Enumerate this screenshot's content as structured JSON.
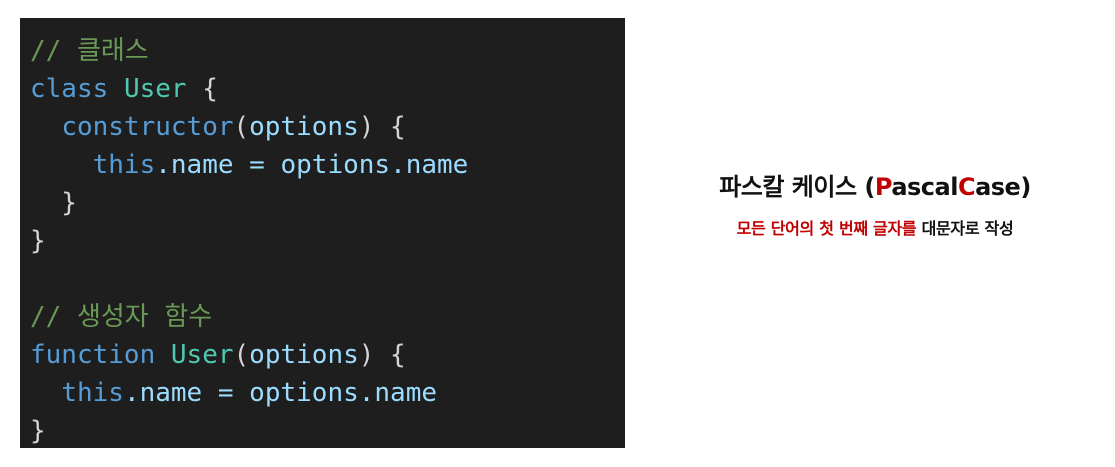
{
  "code": {
    "comment_class": "// 클래스",
    "kw_class": "class",
    "class_name": "User",
    "brace_open": " {",
    "indent1": "  ",
    "ctor": "constructor",
    "paren_open": "(",
    "param_options": "options",
    "paren_close_brace": ") {",
    "indent2": "    ",
    "kw_this": "this",
    "dot_name_eq": ".name = ",
    "options_ref": "options",
    "dot_name": ".name",
    "close_inner": "  }",
    "close_outer": "}",
    "comment_ctor": "// 생성자 함수",
    "kw_function": "function",
    "func_name": "User",
    "close_fn": "}"
  },
  "description": {
    "title_prefix": "파스칼 케이스 (",
    "title_p": "P",
    "title_ascal": "ascal",
    "title_c": "C",
    "title_ase": "ase",
    "title_suffix": ")",
    "sub_highlight": "모든 단어의 첫 번째 글자를",
    "sub_rest": " 대문자로 작성"
  },
  "colors": {
    "code_bg": "#1e1e1e",
    "comment": "#6a9955",
    "keyword": "#569cd6",
    "class_name": "#4ec9b0",
    "function_name": "#dcdcaa",
    "variable": "#9cdcfe",
    "highlight_red": "#c00000"
  }
}
